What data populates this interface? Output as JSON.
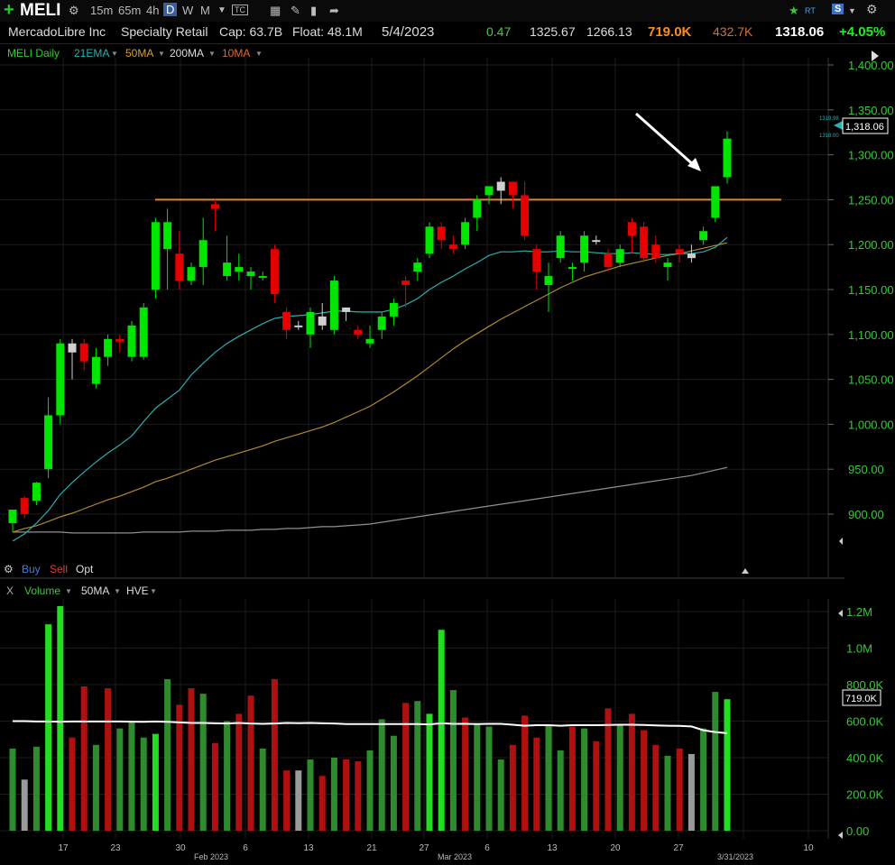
{
  "toolbar": {
    "symbol": "MELI",
    "intervals": [
      "15m",
      "65m",
      "4h",
      "D",
      "W",
      "M"
    ],
    "active_interval": "D",
    "icons": [
      "plus-icon",
      "chart-settings-icon",
      "tc-icon",
      "calculator-icon",
      "draw-icon",
      "eraser-icon",
      "redo-icon",
      "star-icon",
      "rt-icon",
      "s-icon",
      "gear-icon"
    ],
    "rt_label": "RT",
    "tc_label": "TC",
    "s_label": "S"
  },
  "info": {
    "company": "MercadoLibre Inc",
    "sector": "Specialty Retail",
    "cap": "Cap: 63.7B",
    "float": "Float: 48.1M",
    "date": "5/4/2023",
    "change": "0.47",
    "high": "1325.67",
    "low": "1266.13",
    "volume": "719.0K",
    "avg_volume": "432.7K",
    "price": "1318.06",
    "pct_change": "+4.05%"
  },
  "studies": {
    "label": "MELI Daily",
    "items": [
      "21EMA",
      "50MA",
      "200MA",
      "10MA"
    ]
  },
  "trade": {
    "buy": "Buy",
    "sell": "Sell",
    "opt": "Opt"
  },
  "volume_header": {
    "close": "X",
    "label": "Volume",
    "ma": "50MA",
    "hve": "HVE"
  },
  "colors": {
    "up": "#00e600",
    "down": "#e60000",
    "neutral": "#d0d0d0",
    "ema21": "#2ab0b0",
    "ma50": "#b08a30",
    "ma200": "#909090",
    "resistance": "#e0823a",
    "vol_ma": "#ffffff",
    "accent_price": "#ff8c1a",
    "pct_up": "#22ee22"
  },
  "price_axis": {
    "ticks": [
      "1,400.00",
      "1,350.00",
      "1,300.00",
      "1,250.00",
      "1,200.00",
      "1,150.00",
      "1,100.00",
      "1,050.00",
      "1,000.00",
      "950.00",
      "900.00"
    ],
    "last_label": "1,318.06",
    "mini_high": "1319.98",
    "mini_low": "1318.00"
  },
  "volume_axis": {
    "ticks": [
      "1.2M",
      "1.0M",
      "800.0K",
      "600.0K",
      "400.0K",
      "200.0K",
      "0.00"
    ],
    "last_label": "719.0K"
  },
  "date_axis": {
    "labels": [
      "17",
      "23",
      "30",
      "Feb 2023",
      "6",
      "13",
      "21",
      "27",
      "Mar 2023",
      "6",
      "13",
      "20",
      "27",
      "3/31/2023",
      "10"
    ]
  },
  "chart_data": {
    "type": "candlestick",
    "ylim": [
      870,
      1410
    ],
    "resistance": 1250,
    "candles": [
      [
        890,
        905,
        880,
        898,
        "up"
      ],
      [
        900,
        918,
        895,
        920,
        "down"
      ],
      [
        915,
        935,
        910,
        936,
        "up"
      ],
      [
        950,
        1010,
        940,
        1030,
        "up"
      ],
      [
        1010,
        1090,
        1000,
        1095,
        "up"
      ],
      [
        1090,
        1080,
        1050,
        1095,
        "neutral"
      ],
      [
        1090,
        1070,
        1060,
        1095,
        "down"
      ],
      [
        1045,
        1075,
        1040,
        1085,
        "up"
      ],
      [
        1075,
        1095,
        1065,
        1100,
        "up"
      ],
      [
        1095,
        1092,
        1080,
        1100,
        "down"
      ],
      [
        1075,
        1110,
        1070,
        1115,
        "up"
      ],
      [
        1075,
        1130,
        1072,
        1135,
        "up"
      ],
      [
        1150,
        1225,
        1140,
        1230,
        "up"
      ],
      [
        1225,
        1195,
        1150,
        1240,
        "up"
      ],
      [
        1190,
        1160,
        1150,
        1215,
        "down"
      ],
      [
        1160,
        1175,
        1155,
        1180,
        "up"
      ],
      [
        1175,
        1205,
        1155,
        1230,
        "up"
      ],
      [
        1240,
        1245,
        1215,
        1250,
        "down"
      ],
      [
        1165,
        1180,
        1160,
        1210,
        "up"
      ],
      [
        1175,
        1170,
        1160,
        1190,
        "up"
      ],
      [
        1170,
        1165,
        1150,
        1175,
        "up"
      ],
      [
        1165,
        1165,
        1160,
        1170,
        "up"
      ],
      [
        1195,
        1145,
        1135,
        1200,
        "down"
      ],
      [
        1125,
        1105,
        1095,
        1130,
        "down"
      ],
      [
        1110,
        1110,
        1105,
        1115,
        "neutral"
      ],
      [
        1100,
        1125,
        1085,
        1130,
        "up"
      ],
      [
        1120,
        1110,
        1105,
        1135,
        "neutral"
      ],
      [
        1105,
        1160,
        1100,
        1165,
        "up"
      ],
      [
        1125,
        1130,
        1115,
        1130,
        "neutral"
      ],
      [
        1100,
        1105,
        1095,
        1110,
        "down"
      ],
      [
        1090,
        1095,
        1085,
        1110,
        "up"
      ],
      [
        1105,
        1120,
        1095,
        1125,
        "up"
      ],
      [
        1120,
        1135,
        1110,
        1140,
        "up"
      ],
      [
        1160,
        1155,
        1130,
        1165,
        "down"
      ],
      [
        1170,
        1180,
        1160,
        1185,
        "up"
      ],
      [
        1190,
        1220,
        1185,
        1225,
        "up"
      ],
      [
        1220,
        1205,
        1195,
        1225,
        "down"
      ],
      [
        1195,
        1200,
        1190,
        1210,
        "down"
      ],
      [
        1200,
        1225,
        1195,
        1230,
        "up"
      ],
      [
        1230,
        1250,
        1215,
        1255,
        "up"
      ],
      [
        1255,
        1265,
        1245,
        1265,
        "up"
      ],
      [
        1270,
        1260,
        1245,
        1275,
        "neutral"
      ],
      [
        1270,
        1255,
        1240,
        1270,
        "down"
      ],
      [
        1255,
        1210,
        1205,
        1270,
        "down"
      ],
      [
        1195,
        1170,
        1150,
        1200,
        "down"
      ],
      [
        1155,
        1165,
        1125,
        1180,
        "up"
      ],
      [
        1185,
        1210,
        1180,
        1215,
        "up"
      ],
      [
        1175,
        1175,
        1160,
        1180,
        "up"
      ],
      [
        1180,
        1210,
        1170,
        1215,
        "up"
      ],
      [
        1205,
        1205,
        1200,
        1210,
        "neutral"
      ],
      [
        1190,
        1175,
        1170,
        1195,
        "down"
      ],
      [
        1180,
        1195,
        1175,
        1200,
        "up"
      ],
      [
        1225,
        1210,
        1190,
        1230,
        "down"
      ],
      [
        1220,
        1185,
        1180,
        1225,
        "down"
      ],
      [
        1200,
        1185,
        1180,
        1210,
        "down"
      ],
      [
        1175,
        1180,
        1160,
        1185,
        "up"
      ],
      [
        1190,
        1195,
        1180,
        1200,
        "down"
      ],
      [
        1190,
        1185,
        1180,
        1200,
        "neutral"
      ],
      [
        1205,
        1215,
        1200,
        1220,
        "up"
      ],
      [
        1230,
        1265,
        1225,
        1265,
        "up"
      ],
      [
        1275,
        1318,
        1268,
        1326,
        "up"
      ]
    ],
    "ema21": [
      870,
      878,
      890,
      904,
      922,
      935,
      947,
      958,
      968,
      977,
      987,
      1003,
      1018,
      1028,
      1038,
      1055,
      1068,
      1080,
      1090,
      1098,
      1105,
      1112,
      1118,
      1120,
      1121,
      1122,
      1124,
      1126,
      1126,
      1125,
      1125,
      1125,
      1128,
      1133,
      1140,
      1150,
      1158,
      1165,
      1173,
      1180,
      1188,
      1192,
      1192,
      1193,
      1192,
      1192,
      1193,
      1192,
      1192,
      1191,
      1190,
      1190,
      1191,
      1190,
      1189,
      1189,
      1190,
      1190,
      1192,
      1197,
      1208
    ],
    "ma50": [
      880,
      884,
      887,
      892,
      897,
      901,
      906,
      911,
      916,
      920,
      925,
      930,
      936,
      940,
      945,
      950,
      955,
      960,
      964,
      968,
      972,
      976,
      981,
      985,
      989,
      993,
      997,
      1002,
      1008,
      1014,
      1020,
      1028,
      1036,
      1045,
      1054,
      1064,
      1074,
      1084,
      1093,
      1101,
      1109,
      1117,
      1124,
      1131,
      1138,
      1145,
      1152,
      1158,
      1164,
      1168,
      1172,
      1176,
      1179,
      1182,
      1185,
      1188,
      1190,
      1193,
      1196,
      1199,
      1202
    ],
    "ma200": [
      880,
      880,
      880,
      880,
      880,
      879,
      879,
      879,
      879,
      879,
      879,
      880,
      880,
      880,
      880,
      881,
      881,
      881,
      882,
      882,
      882,
      883,
      883,
      884,
      884,
      885,
      886,
      886,
      887,
      888,
      889,
      891,
      893,
      895,
      897,
      899,
      901,
      903,
      905,
      907,
      909,
      911,
      913,
      915,
      917,
      919,
      921,
      923,
      925,
      927,
      929,
      931,
      933,
      935,
      937,
      939,
      941,
      943,
      946,
      949,
      952
    ],
    "volume": [
      450,
      280,
      460,
      1130,
      1230,
      510,
      790,
      470,
      780,
      560,
      600,
      510,
      530,
      830,
      690,
      780,
      750,
      480,
      600,
      640,
      740,
      450,
      830,
      330,
      330,
      390,
      300,
      400,
      390,
      380,
      440,
      610,
      520,
      700,
      710,
      640,
      1100,
      770,
      620,
      580,
      570,
      390,
      470,
      630,
      510,
      580,
      440,
      570,
      560,
      490,
      670,
      580,
      640,
      550,
      470,
      410,
      450,
      420,
      560,
      760,
      720
    ],
    "volume_colors": [
      "darkgreen",
      "grey",
      "darkgreen",
      "green",
      "green",
      "darkred",
      "darkred",
      "darkgreen",
      "darkred",
      "darkgreen",
      "darkgreen",
      "darkgreen",
      "green",
      "darkgreen",
      "darkred",
      "darkred",
      "darkgreen",
      "darkred",
      "darkgreen",
      "darkred",
      "darkred",
      "darkgreen",
      "darkred",
      "darkred",
      "grey",
      "darkgreen",
      "darkred",
      "darkgreen",
      "darkred",
      "darkred",
      "darkgreen",
      "darkgreen",
      "darkgreen",
      "darkred",
      "darkgreen",
      "green",
      "green",
      "darkgreen",
      "darkred",
      "darkgreen",
      "darkgreen",
      "darkgreen",
      "darkred",
      "darkred",
      "darkred",
      "darkgreen",
      "darkgreen",
      "darkred",
      "darkgreen",
      "darkred",
      "darkred",
      "darkgreen",
      "darkred",
      "darkred",
      "darkred",
      "darkgreen",
      "darkred",
      "grey",
      "darkgreen",
      "darkgreen",
      "green"
    ],
    "volume_ma": [
      600,
      600,
      598,
      598,
      597,
      598,
      598,
      598,
      598,
      598,
      597,
      596,
      598,
      596,
      593,
      590,
      590,
      588,
      587,
      590,
      587,
      585,
      587,
      590,
      589,
      590,
      588,
      587,
      584,
      584,
      584,
      584,
      584,
      584,
      584,
      582,
      588,
      585,
      585,
      584,
      585,
      585,
      580,
      575,
      578,
      578,
      575,
      578,
      578,
      578,
      579,
      580,
      580,
      579,
      577,
      575,
      574,
      571,
      550,
      540,
      534
    ],
    "volume_ylim": [
      0,
      1300
    ]
  }
}
